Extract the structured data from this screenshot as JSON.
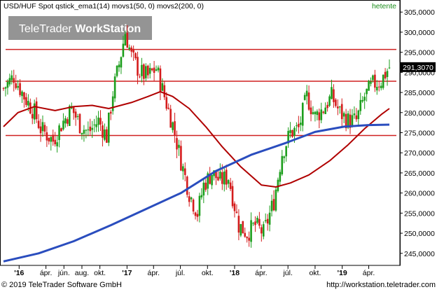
{
  "header": {
    "title": "USD/HUF Spot qstick_ema1(14) movs1(50, 0) movs2(200, 0)",
    "period": "hetente",
    "watermark_prefix": "TeleTrader ",
    "watermark_bold": "WorkStation"
  },
  "footer": {
    "copyright": "© 2019 TeleTrader Software GmbH",
    "url": "http://workstation.teletrader.com"
  },
  "chart_data": {
    "type": "candlestick",
    "instrument": "USD/HUF Spot",
    "frequency": "hetente",
    "last_value": 291.307,
    "last_value_label": "291,3070",
    "ylim": [
      242,
      308
    ],
    "y_ticks": [
      245,
      250,
      255,
      260,
      265,
      270,
      275,
      280,
      285,
      290,
      295,
      300,
      305
    ],
    "y_tick_labels": [
      "245,0000",
      "250,0000",
      "255,0000",
      "260,0000",
      "265,0000",
      "270,0000",
      "275,0000",
      "280,0000",
      "285,0000",
      "290,0000",
      "295,0000",
      "300,0000",
      "305,0000"
    ],
    "x_ticks": [
      {
        "label": "'16",
        "date": "2016-01-01",
        "bold": true
      },
      {
        "label": "ápr.",
        "date": "2016-04-01",
        "bold": false
      },
      {
        "label": "jún.",
        "date": "2016-06-01",
        "bold": false
      },
      {
        "label": "aug.",
        "date": "2016-08-01",
        "bold": false
      },
      {
        "label": "okt.",
        "date": "2016-10-01",
        "bold": false
      },
      {
        "label": "'17",
        "date": "2017-01-01",
        "bold": true
      },
      {
        "label": "ápr.",
        "date": "2017-04-01",
        "bold": false
      },
      {
        "label": "júl.",
        "date": "2017-07-01",
        "bold": false
      },
      {
        "label": "okt.",
        "date": "2017-10-01",
        "bold": false
      },
      {
        "label": "'18",
        "date": "2018-01-01",
        "bold": true
      },
      {
        "label": "ápr.",
        "date": "2018-04-01",
        "bold": false
      },
      {
        "label": "júl.",
        "date": "2018-07-01",
        "bold": false
      },
      {
        "label": "okt.",
        "date": "2018-10-01",
        "bold": false
      },
      {
        "label": "'19",
        "date": "2019-01-01",
        "bold": true
      },
      {
        "label": "ápr.",
        "date": "2019-04-01",
        "bold": false
      }
    ],
    "x_range": [
      "2015-11-09",
      "2019-06-10"
    ],
    "horizontal_lines": [
      295.7,
      287.8,
      274.3
    ],
    "close_anchors": [
      {
        "date": "2015-11-09",
        "close": 286.0
      },
      {
        "date": "2015-12-14",
        "close": 289.0
      },
      {
        "date": "2016-01-18",
        "close": 284.0
      },
      {
        "date": "2016-02-22",
        "close": 280.0
      },
      {
        "date": "2016-03-14",
        "close": 276.0
      },
      {
        "date": "2016-04-25",
        "close": 273.0
      },
      {
        "date": "2016-05-23",
        "close": 277.0
      },
      {
        "date": "2016-06-27",
        "close": 281.0
      },
      {
        "date": "2016-07-25",
        "close": 277.0
      },
      {
        "date": "2016-08-22",
        "close": 275.0
      },
      {
        "date": "2016-09-26",
        "close": 278.0
      },
      {
        "date": "2016-10-24",
        "close": 274.0
      },
      {
        "date": "2016-11-14",
        "close": 285.0
      },
      {
        "date": "2016-12-05",
        "close": 292.0
      },
      {
        "date": "2016-12-26",
        "close": 300.0
      },
      {
        "date": "2017-01-16",
        "close": 294.0
      },
      {
        "date": "2017-02-13",
        "close": 290.0
      },
      {
        "date": "2017-03-13",
        "close": 289.0
      },
      {
        "date": "2017-04-10",
        "close": 291.0
      },
      {
        "date": "2017-05-08",
        "close": 284.0
      },
      {
        "date": "2017-06-05",
        "close": 277.0
      },
      {
        "date": "2017-07-03",
        "close": 268.0
      },
      {
        "date": "2017-07-31",
        "close": 260.0
      },
      {
        "date": "2017-08-28",
        "close": 255.0
      },
      {
        "date": "2017-09-18",
        "close": 262.0
      },
      {
        "date": "2017-10-16",
        "close": 265.0
      },
      {
        "date": "2017-11-13",
        "close": 263.0
      },
      {
        "date": "2017-12-11",
        "close": 264.0
      },
      {
        "date": "2018-01-15",
        "close": 252.0
      },
      {
        "date": "2018-02-12",
        "close": 250.0
      },
      {
        "date": "2018-03-12",
        "close": 252.0
      },
      {
        "date": "2018-04-09",
        "close": 250.0
      },
      {
        "date": "2018-05-14",
        "close": 258.0
      },
      {
        "date": "2018-06-11",
        "close": 270.0
      },
      {
        "date": "2018-07-09",
        "close": 275.0
      },
      {
        "date": "2018-08-06",
        "close": 276.0
      },
      {
        "date": "2018-09-03",
        "close": 284.0
      },
      {
        "date": "2018-10-01",
        "close": 279.0
      },
      {
        "date": "2018-10-29",
        "close": 281.0
      },
      {
        "date": "2018-11-26",
        "close": 284.0
      },
      {
        "date": "2018-12-24",
        "close": 280.0
      },
      {
        "date": "2019-01-21",
        "close": 278.0
      },
      {
        "date": "2019-02-18",
        "close": 278.0
      },
      {
        "date": "2019-03-18",
        "close": 284.0
      },
      {
        "date": "2019-04-15",
        "close": 287.0
      },
      {
        "date": "2019-05-13",
        "close": 288.0
      },
      {
        "date": "2019-06-10",
        "close": 291.307
      }
    ],
    "series": [
      {
        "name": "ema1(14)",
        "color": "#b00000",
        "points": [
          {
            "date": "2015-11-09",
            "value": 276.5
          },
          {
            "date": "2015-12-28",
            "value": 280.0
          },
          {
            "date": "2016-02-22",
            "value": 281.5
          },
          {
            "date": "2016-05-02",
            "value": 280.5
          },
          {
            "date": "2016-07-04",
            "value": 281.5
          },
          {
            "date": "2016-09-05",
            "value": 281.8
          },
          {
            "date": "2016-10-31",
            "value": 281.0
          },
          {
            "date": "2017-01-16",
            "value": 282.5
          },
          {
            "date": "2017-03-13",
            "value": 284.0
          },
          {
            "date": "2017-04-24",
            "value": 285.2
          },
          {
            "date": "2017-06-05",
            "value": 284.0
          },
          {
            "date": "2017-07-31",
            "value": 281.0
          },
          {
            "date": "2017-09-25",
            "value": 276.5
          },
          {
            "date": "2017-11-20",
            "value": 271.5
          },
          {
            "date": "2018-01-22",
            "value": 266.5
          },
          {
            "date": "2018-04-02",
            "value": 262.0
          },
          {
            "date": "2018-05-21",
            "value": 261.5
          },
          {
            "date": "2018-07-09",
            "value": 262.5
          },
          {
            "date": "2018-09-10",
            "value": 264.5
          },
          {
            "date": "2018-11-19",
            "value": 268.0
          },
          {
            "date": "2019-01-21",
            "value": 272.0
          },
          {
            "date": "2019-03-18",
            "value": 276.0
          },
          {
            "date": "2019-05-13",
            "value": 279.5
          },
          {
            "date": "2019-06-10",
            "value": 281.0
          }
        ]
      },
      {
        "name": "movs1(50, 0)",
        "color": "#2a4dbe",
        "points": [
          {
            "date": "2015-11-09",
            "value": 243.0
          },
          {
            "date": "2016-03-07",
            "value": 245.0
          },
          {
            "date": "2016-07-04",
            "value": 248.0
          },
          {
            "date": "2016-11-07",
            "value": 252.0
          },
          {
            "date": "2017-03-06",
            "value": 256.0
          },
          {
            "date": "2017-07-03",
            "value": 260.0
          },
          {
            "date": "2017-10-30",
            "value": 265.5
          },
          {
            "date": "2018-02-26",
            "value": 269.5
          },
          {
            "date": "2018-06-25",
            "value": 272.5
          },
          {
            "date": "2018-10-01",
            "value": 275.2
          },
          {
            "date": "2019-01-07",
            "value": 276.5
          },
          {
            "date": "2019-04-01",
            "value": 276.9
          },
          {
            "date": "2019-06-10",
            "value": 277.0
          }
        ]
      }
    ]
  }
}
